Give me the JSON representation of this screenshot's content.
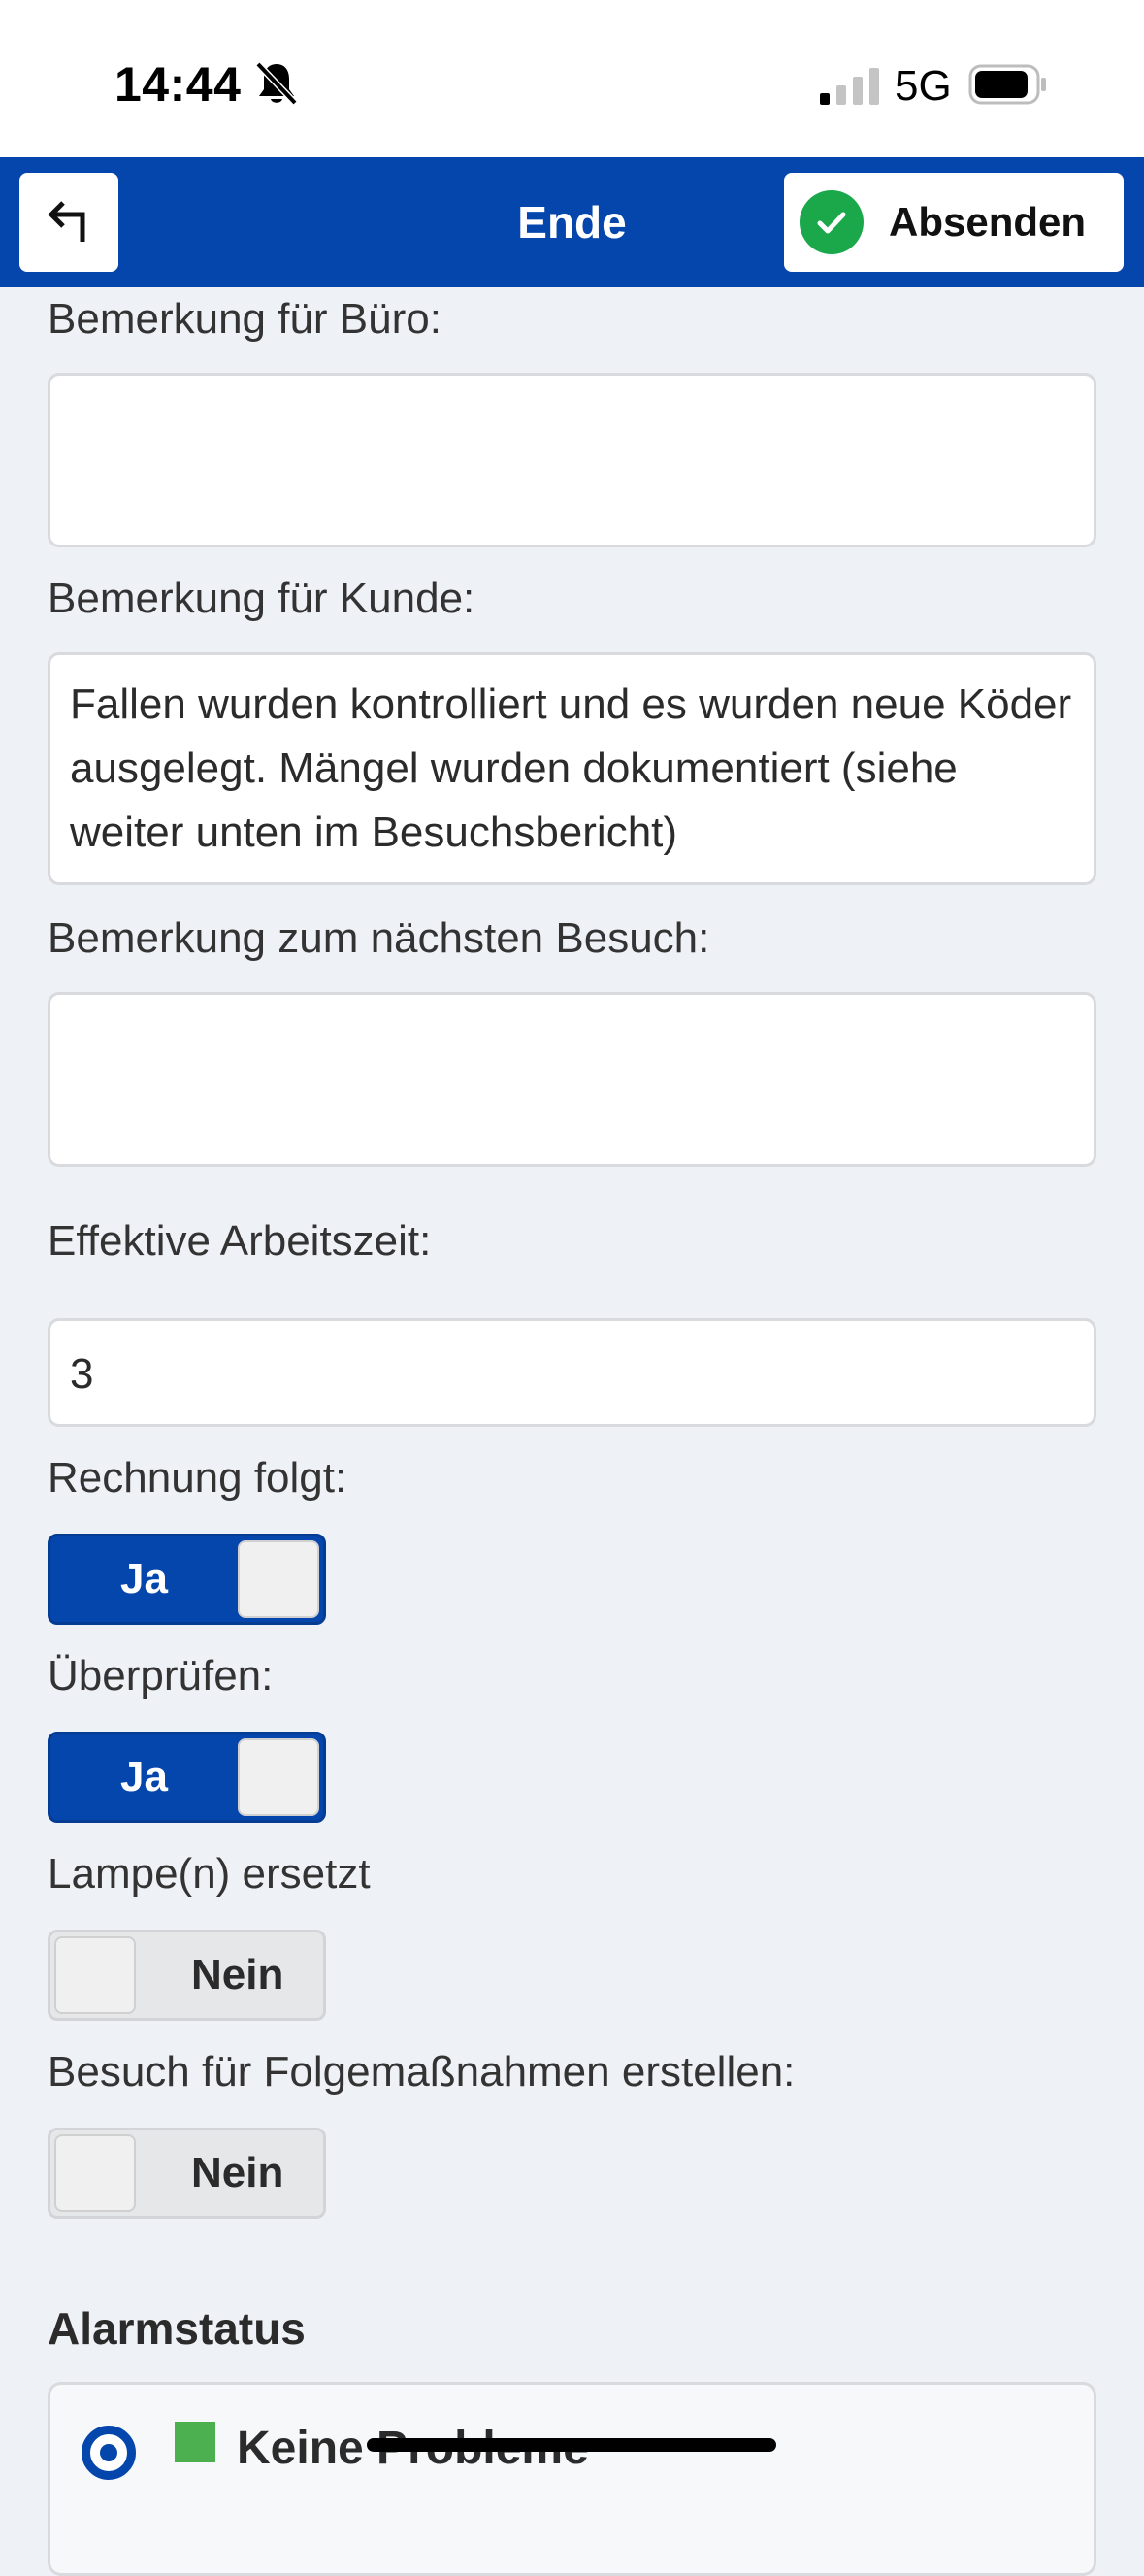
{
  "status_bar": {
    "time": "14:44",
    "network": "5G",
    "icons": [
      "bell-slash-icon",
      "signal-icon",
      "battery-icon"
    ]
  },
  "nav": {
    "back_icon": "back-arrow-icon",
    "title": "Ende",
    "submit_label": "Absenden",
    "submit_icon": "check-circle-icon",
    "accent_color": "#0546ad",
    "check_color": "#1aa84b"
  },
  "form": {
    "office_note": {
      "label": "Bemerkung für Büro:",
      "value": ""
    },
    "customer_note": {
      "label": "Bemerkung für Kunde:",
      "value": "Fallen wurden kontrolliert und es wurden neue Köder ausgelegt. Mängel wurden dokumentiert (siehe weiter unten im Besuchsbericht)"
    },
    "next_visit_note": {
      "label": "Bemerkung zum nächsten Besuch:",
      "value": ""
    },
    "work_time": {
      "label": "Effektive Arbeitszeit:",
      "value": "3"
    },
    "invoice_follows": {
      "label": "Rechnung folgt:",
      "state": "Ja",
      "on": true
    },
    "check": {
      "label": "Überprüfen:",
      "state": "Ja",
      "on": true
    },
    "lamps_replaced": {
      "label": "Lampe(n) ersetzt",
      "state": "Nein",
      "on": false
    },
    "followup_visit": {
      "label": "Besuch für Folgemaßnahmen erstellen:",
      "state": "Nein",
      "on": false
    }
  },
  "alarm": {
    "title": "Alarmstatus",
    "options": [
      {
        "label": "Keine Probleme",
        "selected": true,
        "color": "#4caf50"
      }
    ]
  }
}
